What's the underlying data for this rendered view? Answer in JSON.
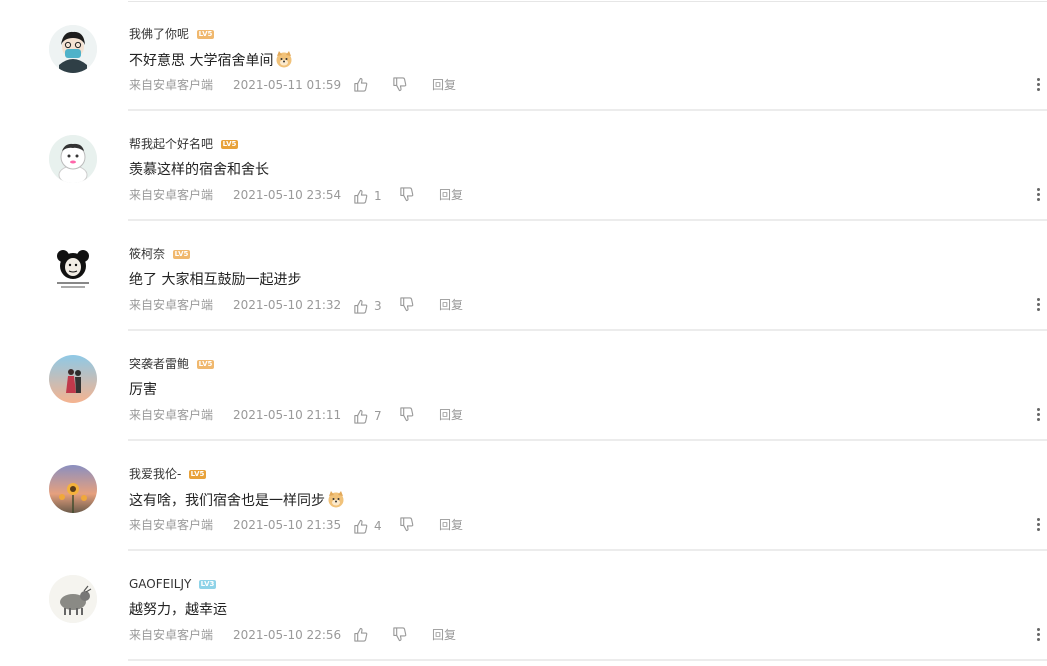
{
  "comments": [
    {
      "username": "我佛了你呢",
      "level": "LV5",
      "level_color": "#f0b86e",
      "text": "不好意思 大学宿舍单间",
      "has_emoji": true,
      "source": "来自安卓客户端",
      "time": "2021-05-11 01:59",
      "likes": "",
      "reply_label": "回复"
    },
    {
      "username": "帮我起个好名吧",
      "level": "LV5",
      "level_color": "#e8a23a",
      "text": "羡慕这样的宿舍和舍长",
      "has_emoji": false,
      "source": "来自安卓客户端",
      "time": "2021-05-10 23:54",
      "likes": "1",
      "reply_label": "回复"
    },
    {
      "username": "筱柯奈",
      "level": "LV5",
      "level_color": "#f0b86e",
      "text": "绝了 大家相互鼓励一起进步",
      "has_emoji": false,
      "source": "来自安卓客户端",
      "time": "2021-05-10 21:32",
      "likes": "3",
      "reply_label": "回复"
    },
    {
      "username": "突袭者雷鲍",
      "level": "LV5",
      "level_color": "#f0b86e",
      "text": "厉害",
      "has_emoji": false,
      "source": "来自安卓客户端",
      "time": "2021-05-10 21:11",
      "likes": "7",
      "reply_label": "回复"
    },
    {
      "username": "我爱我伦-",
      "level": "LV5",
      "level_color": "#e8a23a",
      "text": "这有啥，我们宿舍也是一样同步",
      "has_emoji": true,
      "source": "来自安卓客户端",
      "time": "2021-05-10 21:35",
      "likes": "4",
      "reply_label": "回复"
    },
    {
      "username": "GAOFEILJY",
      "level": "LV3",
      "level_color": "#8fd3e8",
      "text": "越努力，越幸运",
      "has_emoji": false,
      "source": "来自安卓客户端",
      "time": "2021-05-10 22:56",
      "likes": "",
      "reply_label": "回复"
    }
  ]
}
